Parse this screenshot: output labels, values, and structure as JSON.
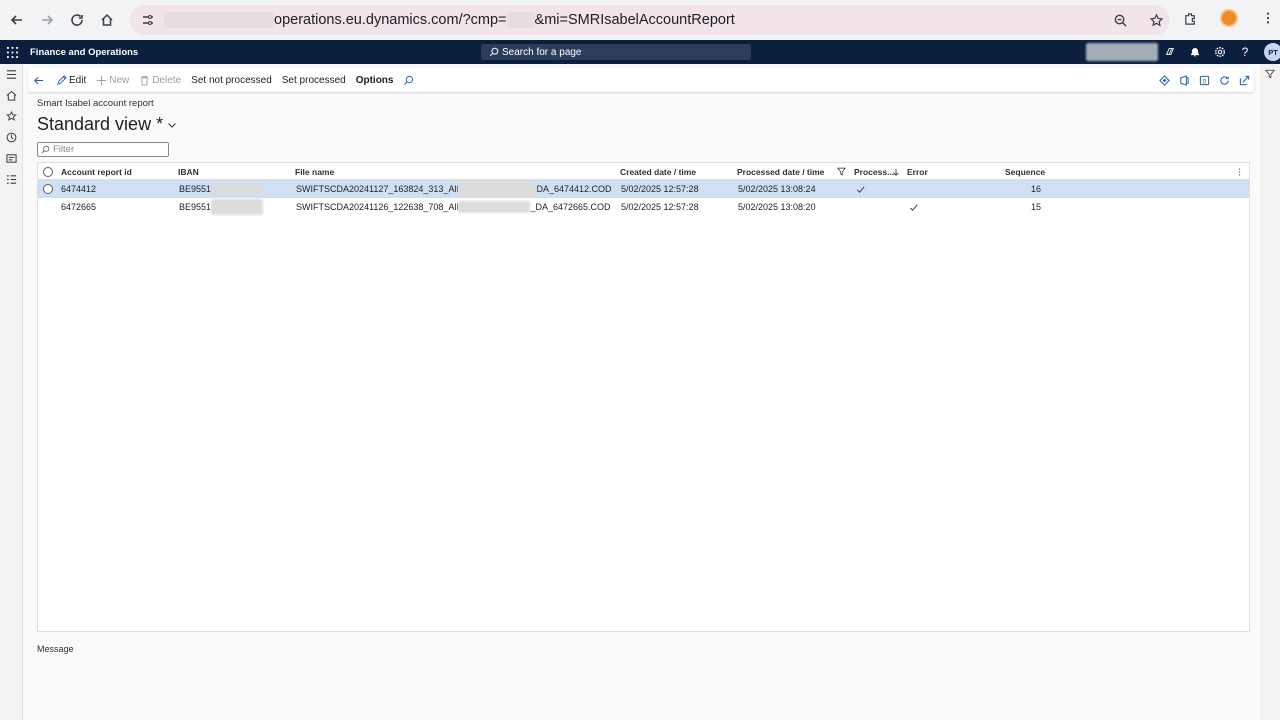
{
  "browser": {
    "url_host": "operations.eu.dynamics.com/?cmp=",
    "url_rest": "&mi=SMRIsabelAccountReport"
  },
  "header": {
    "app_name": "Finance and Operations",
    "search_placeholder": "Search for a page",
    "user_initials": "PT"
  },
  "actions": {
    "edit": "Edit",
    "new": "New",
    "delete": "Delete",
    "set_not_processed": "Set not processed",
    "set_processed": "Set processed",
    "options": "Options"
  },
  "page": {
    "breadcrumb": "Smart Isabel account report",
    "view_title": "Standard view *",
    "filter_placeholder": "Filter"
  },
  "grid": {
    "columns": [
      "Account report id",
      "IBAN",
      "File name",
      "Created date / time",
      "Processed date / time",
      "Process...",
      "Error",
      "Sequence"
    ],
    "rows": [
      {
        "account_report_id": "6474412",
        "iban_prefix": "BE9551",
        "file_name_start": "SWIFTSCDA20241127_163824_313_All",
        "file_name_end": "DA_6474412.COD",
        "created": "5/02/2025 12:57:28",
        "processed_dt": "5/02/2025 13:08:24",
        "processed": true,
        "error": false,
        "sequence": "16",
        "selected": true
      },
      {
        "account_report_id": "6472665",
        "iban_prefix": "BE9551",
        "file_name_start": "SWIFTSCDA20241126_122638_708_All",
        "file_name_end": "_DA_6472665.COD",
        "created": "5/02/2025 12:57:28",
        "processed_dt": "5/02/2025 13:08:20",
        "processed": false,
        "error": true,
        "sequence": "15",
        "selected": false
      }
    ]
  },
  "footer": {
    "message_label": "Message"
  }
}
